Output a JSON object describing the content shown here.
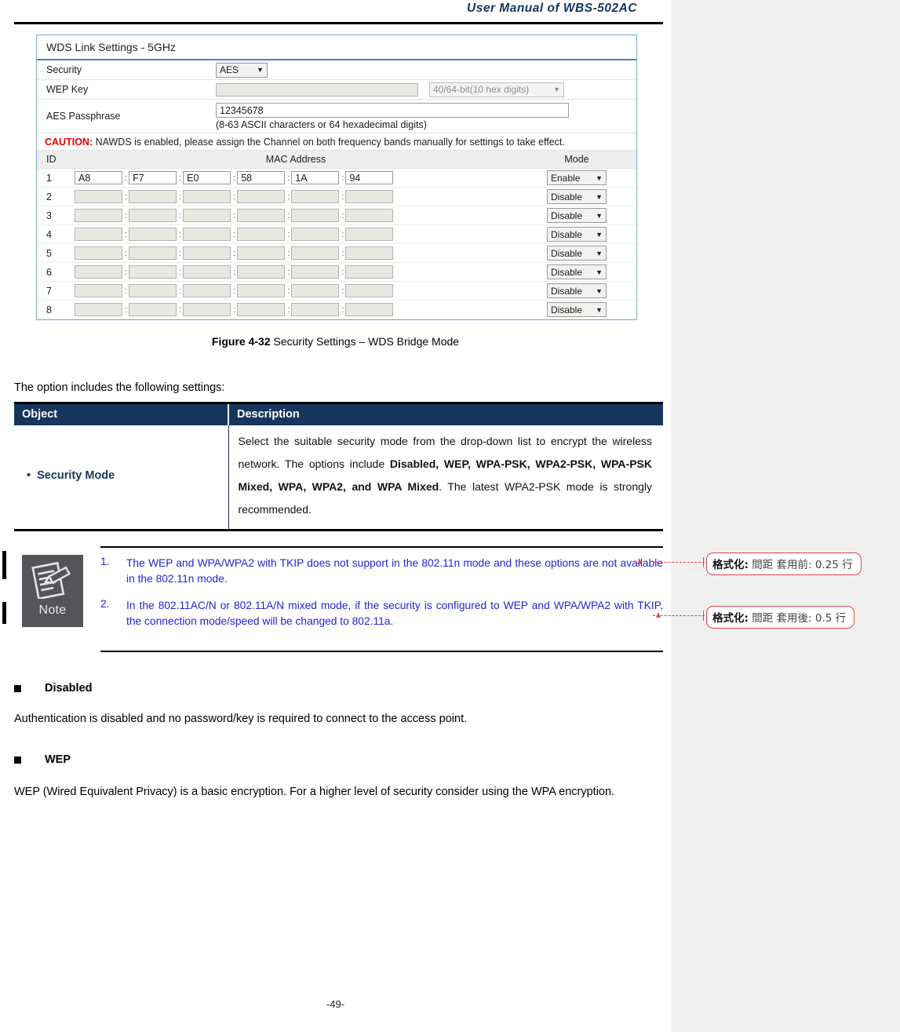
{
  "header": {
    "title": "User  Manual  of  WBS-502AC"
  },
  "ui_panel": {
    "title": "WDS Link Settings - 5GHz",
    "security_label": "Security",
    "security_value": "AES",
    "wep_key_label": "WEP Key",
    "wep_key_value": "",
    "wep_key_type_value": "40/64-bit(10 hex digits)",
    "aes_passphrase_label": "AES Passphrase",
    "aes_passphrase_value": "12345678",
    "aes_passphrase_hint": "(8-63 ASCII characters or 64 hexadecimal digits)",
    "caution_word": "CAUTION:",
    "caution_text": "NAWDS is enabled, please assign the Channel on both frequency bands manually for settings to take effect.",
    "table": {
      "columns": [
        "ID",
        "MAC Address",
        "Mode"
      ],
      "rows": [
        {
          "id": "1",
          "octets": [
            "A8",
            "F7",
            "E0",
            "58",
            "1A",
            "94"
          ],
          "mode": "Enable",
          "enabled": true
        },
        {
          "id": "2",
          "octets": [
            "",
            "",
            "",
            "",
            "",
            ""
          ],
          "mode": "Disable",
          "enabled": false
        },
        {
          "id": "3",
          "octets": [
            "",
            "",
            "",
            "",
            "",
            ""
          ],
          "mode": "Disable",
          "enabled": false
        },
        {
          "id": "4",
          "octets": [
            "",
            "",
            "",
            "",
            "",
            ""
          ],
          "mode": "Disable",
          "enabled": false
        },
        {
          "id": "5",
          "octets": [
            "",
            "",
            "",
            "",
            "",
            ""
          ],
          "mode": "Disable",
          "enabled": false
        },
        {
          "id": "6",
          "octets": [
            "",
            "",
            "",
            "",
            "",
            ""
          ],
          "mode": "Disable",
          "enabled": false
        },
        {
          "id": "7",
          "octets": [
            "",
            "",
            "",
            "",
            "",
            ""
          ],
          "mode": "Disable",
          "enabled": false
        },
        {
          "id": "8",
          "octets": [
            "",
            "",
            "",
            "",
            "",
            ""
          ],
          "mode": "Disable",
          "enabled": false
        }
      ]
    }
  },
  "figure": {
    "label": "Figure 4-32",
    "caption": " Security Settings – WDS Bridge Mode"
  },
  "intro_line": "The option includes the following settings:",
  "object_table": {
    "header_object": "Object",
    "header_description": "Description",
    "row_object": "Security Mode",
    "row_description_part1": "Select the suitable security mode from the drop-down list to encrypt the wireless network. The options include ",
    "row_description_bold1": "Disabled, WEP, WPA-PSK, WPA2-PSK, WPA-PSK Mixed, WPA, WPA2, and WPA Mixed",
    "row_description_part2": ". The latest WPA2-PSK mode is strongly recommended."
  },
  "note": {
    "icon_label": "Note",
    "items": [
      {
        "num": "1.",
        "text": "The WEP and WPA/WPA2 with TKIP does not support in the 802.11n mode and these options are not available in the 802.11n mode."
      },
      {
        "num": "2.",
        "text": "In the 802.11AC/N or 802.11A/N mixed mode, if the security is configured to WEP and WPA/WPA2 with TKIP, the connection mode/speed will be changed to 802.11a."
      }
    ]
  },
  "sections": [
    {
      "heading": "Disabled",
      "paragraph": "Authentication is disabled and no password/key is required to connect to the access point."
    },
    {
      "heading": "WEP",
      "paragraph": "WEP (Wired Equivalent Privacy) is a basic encryption. For a higher level of security consider using the WPA encryption."
    }
  ],
  "callouts": [
    {
      "key": "格式化:",
      "value": " 間距 套用前: 0.25 行"
    },
    {
      "key": "格式化:",
      "value": " 間距 套用後: 0.5 行"
    }
  ],
  "page_number": "-49-",
  "colors": {
    "header_navy": "#15355e",
    "table_header_navy": "#17365d",
    "caution_red": "#e40000",
    "note_blue": "#2222dd",
    "callout_red": "#e8424c",
    "panel_border_blue": "#7aa8d4"
  }
}
